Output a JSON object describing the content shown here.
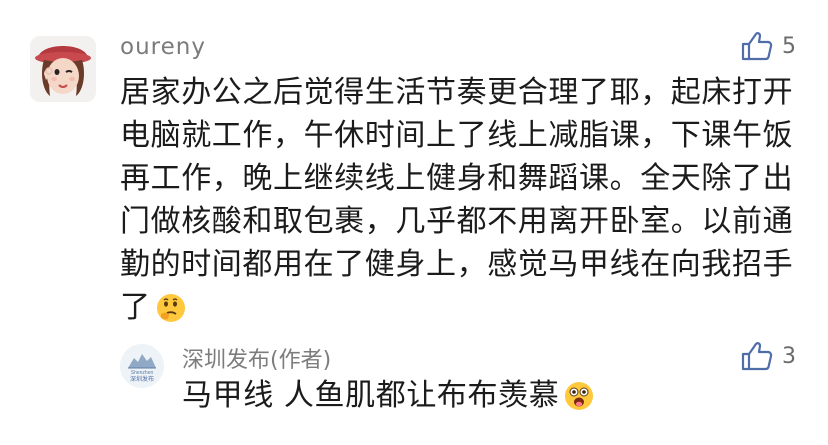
{
  "comment": {
    "username": "oureny",
    "likes": "5",
    "content": "居家办公之后觉得生活节奏更合理了耶，起床打开电脑就工作，午休时间上了线上减脂课，下课午饭再工作，晚上继续线上健身和舞蹈课。全天除了出门做核酸和取包裹，几乎都不用离开卧室。以前通勤的时间都用在了健身上，感觉马甲线在向我招手了",
    "content_emoji": "thinking-face-emoji",
    "avatar": {
      "icon": "user-avatar-icon"
    }
  },
  "reply": {
    "author": "深圳发布(作者)",
    "likes": "3",
    "content": "马甲线 人鱼肌都让布布羡慕",
    "content_emoji": "astonished-face-emoji",
    "avatar": {
      "icon": "shenzhen-avatar-icon",
      "logo_text": "深圳发布",
      "logo_subtext": "Shenzhen"
    }
  },
  "colors": {
    "text": "#1b1b1b",
    "muted": "#7b7b7b",
    "accent": "#4f6ea8"
  }
}
